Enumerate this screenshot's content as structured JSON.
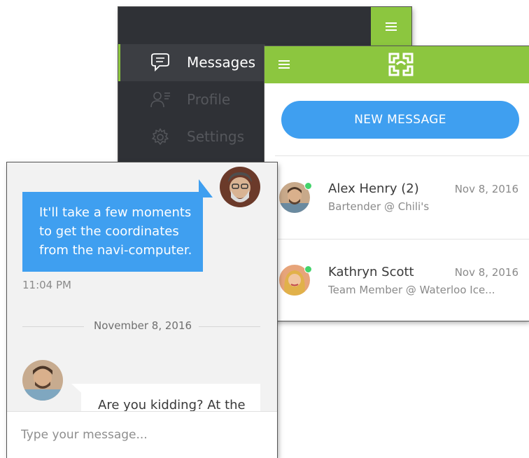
{
  "side_menu": {
    "items": [
      {
        "label": "Messages",
        "icon": "chat-bubble-icon"
      },
      {
        "label": "Profile",
        "icon": "profile-card-icon"
      },
      {
        "label": "Settings",
        "icon": "gear-icon"
      }
    ]
  },
  "inbox": {
    "new_message_label": "NEW MESSAGE",
    "conversations": [
      {
        "name": "Alex Henry (2)",
        "date": "Nov 8, 2016",
        "subtitle": "Bartender @ Chili's",
        "online": true
      },
      {
        "name": "Kathryn Scott",
        "date": "Nov 8, 2016",
        "subtitle": "Team Member @ Waterloo Ice...",
        "online": true
      }
    ]
  },
  "chat": {
    "messages": [
      {
        "text_lines": [
          "It'll take a few moments",
          "to get the coordinates",
          "from the navi-computer."
        ],
        "time": "11:04 PM"
      },
      {
        "text": "Are you kidding? At the"
      }
    ],
    "date_divider": "November 8, 2016",
    "composer_placeholder": "Type your message..."
  },
  "colors": {
    "accent_green": "#8cc63f",
    "accent_blue": "#3f9ff0",
    "menu_dark": "#2f3136",
    "online_dot": "#43d36b"
  }
}
